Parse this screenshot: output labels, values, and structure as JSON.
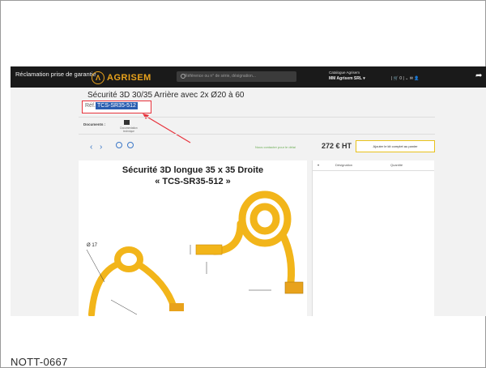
{
  "video": {
    "title": "Réclamation prise de garantie",
    "brand": "AGRISEM",
    "search_placeholder": "Référence ou n° de série, désignation...",
    "account_label": "Catalogue Agrisem",
    "account_name": "MM Agrisem SRL ▾",
    "cart": "| 🛒 0 | ⌄ ✉ 👤"
  },
  "product": {
    "title": "Sécurité 3D 30/35 Arrière avec 2x Ø20 à 60",
    "ref_label": "Réf.",
    "ref_code": "TCS-SR35-512",
    "documents_label": "Documents :",
    "document_caption": "Documentation technique",
    "contact_text": "Nous contacter pour le délai",
    "price": "272 € HT",
    "add_button": "Ajouter le kit complet au panier"
  },
  "drawing": {
    "title_line1": "Sécurité 3D longue 35 x 35 Droite",
    "title_line2": "« TCS-SR35-512 »",
    "dim_diameter": "Ø 17"
  },
  "table": {
    "headers": [
      "Désignation",
      "Quantité"
    ]
  },
  "caption": "NOTT-0667",
  "colors": {
    "highlight_box": "#e8323c",
    "selected_text": "#2a5db0",
    "brand": "#e8a21c",
    "spring": "#f2b51a"
  }
}
